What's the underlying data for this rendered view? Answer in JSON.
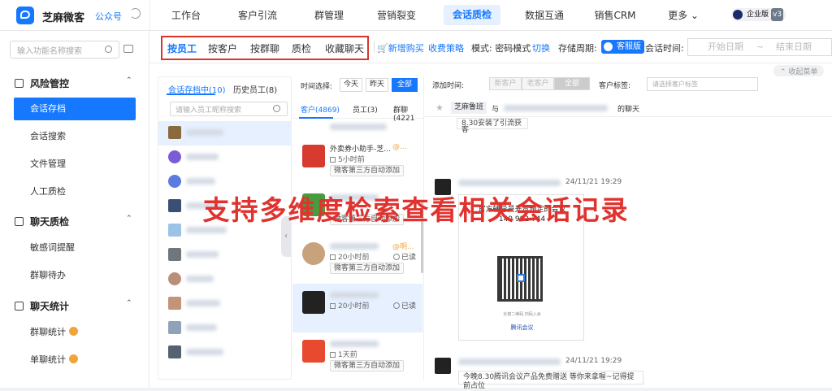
{
  "app": {
    "brand": "芝麻微客",
    "gzh": "公众号"
  },
  "nav": [
    {
      "label": "工作台"
    },
    {
      "label": "客户引流"
    },
    {
      "label": "群管理"
    },
    {
      "label": "营销裂变"
    },
    {
      "label": "会话质检"
    },
    {
      "label": "数据互通"
    },
    {
      "label": "销售CRM"
    },
    {
      "label": "更多 ⌄"
    }
  ],
  "enterprise": {
    "label": "企业版",
    "version": "v3"
  },
  "sidebar": {
    "search_placeholder": "输入功能名称搜索",
    "groups": [
      {
        "title": "风险管控",
        "items": [
          "会话存档",
          "会话搜索",
          "文件管理",
          "人工质检"
        ]
      },
      {
        "title": "聊天质检",
        "items": [
          "敏感词提醒",
          "群聊待办"
        ]
      },
      {
        "title": "聊天统计",
        "items": [
          "群聊统计",
          "单聊统计"
        ]
      }
    ]
  },
  "filters": {
    "tabs": [
      "按员工",
      "按客户",
      "按群聊",
      "质检",
      "收藏聊天"
    ],
    "new_purchase": "新增购买",
    "pricing": "收费策略",
    "mode": "模式: 密码模式",
    "switch": "切换",
    "storage": "存储周期:",
    "storage_badge": "客服版",
    "session_time": "会话时间:",
    "start_date": "开始日期",
    "tilde": "~",
    "end_date": "结束日期",
    "collapse_menu": "收起菜单"
  },
  "left": {
    "tabs": [
      "会话存档中(10)",
      "历史员工(8)"
    ],
    "search_placeholder": "请输入员工昵称搜索"
  },
  "middle": {
    "time_label": "时间选择:",
    "time_buttons": [
      "今天",
      "昨天",
      "全部"
    ],
    "tabs": [
      "客户(4869)",
      "员工(3)",
      "群聊(4221"
    ],
    "conversations": [
      {
        "title": "外卖券小助手-芝...",
        "at": "@...",
        "time": "5小时前",
        "tag": "微客第三方自动添加"
      },
      {
        "title": "",
        "at": "",
        "time": "",
        "tag": "微客第三方自动添加"
      },
      {
        "title": "",
        "at": "@明...",
        "time": "20小时前",
        "tag": "微客第三方自动添加",
        "read": "已读"
      },
      {
        "title": "",
        "at": "",
        "time": "20小时前",
        "tag": "",
        "read": "已读"
      },
      {
        "title": "",
        "at": "",
        "time": "1天前",
        "tag": "微客第三方自动添加"
      }
    ],
    "top_snippet": "8.30安装了引流获客"
  },
  "right": {
    "add_time_label": "添加时间:",
    "add_time_buttons": [
      "新客户",
      "老客户",
      "全部"
    ],
    "customer_tag_label": "客户标签:",
    "customer_tag_placeholder": "请选择客户标签",
    "chat_header": {
      "chip": "芝麻鲁班",
      "with": "与",
      "suffix": "的聊天"
    },
    "messages": [
      {
        "time": "24/11/21 19:29"
      },
      {
        "time": "24/11/21 19:29",
        "text": "今晚8.30腾讯会议产品免费赠送 等你来拿喔~记得提前占位"
      }
    ],
    "card": {
      "title": "官方辅导员光贵预定的会议",
      "meeting_id": "140 982 744",
      "caption": "长按二维码 扫码入会",
      "brand": "腾讯会议"
    }
  },
  "overlay": "支持多维度检索查看相关会话记录",
  "colors": {
    "primary": "#1677ff",
    "highlight": "#d9352b",
    "overlay": "#e0332f"
  }
}
